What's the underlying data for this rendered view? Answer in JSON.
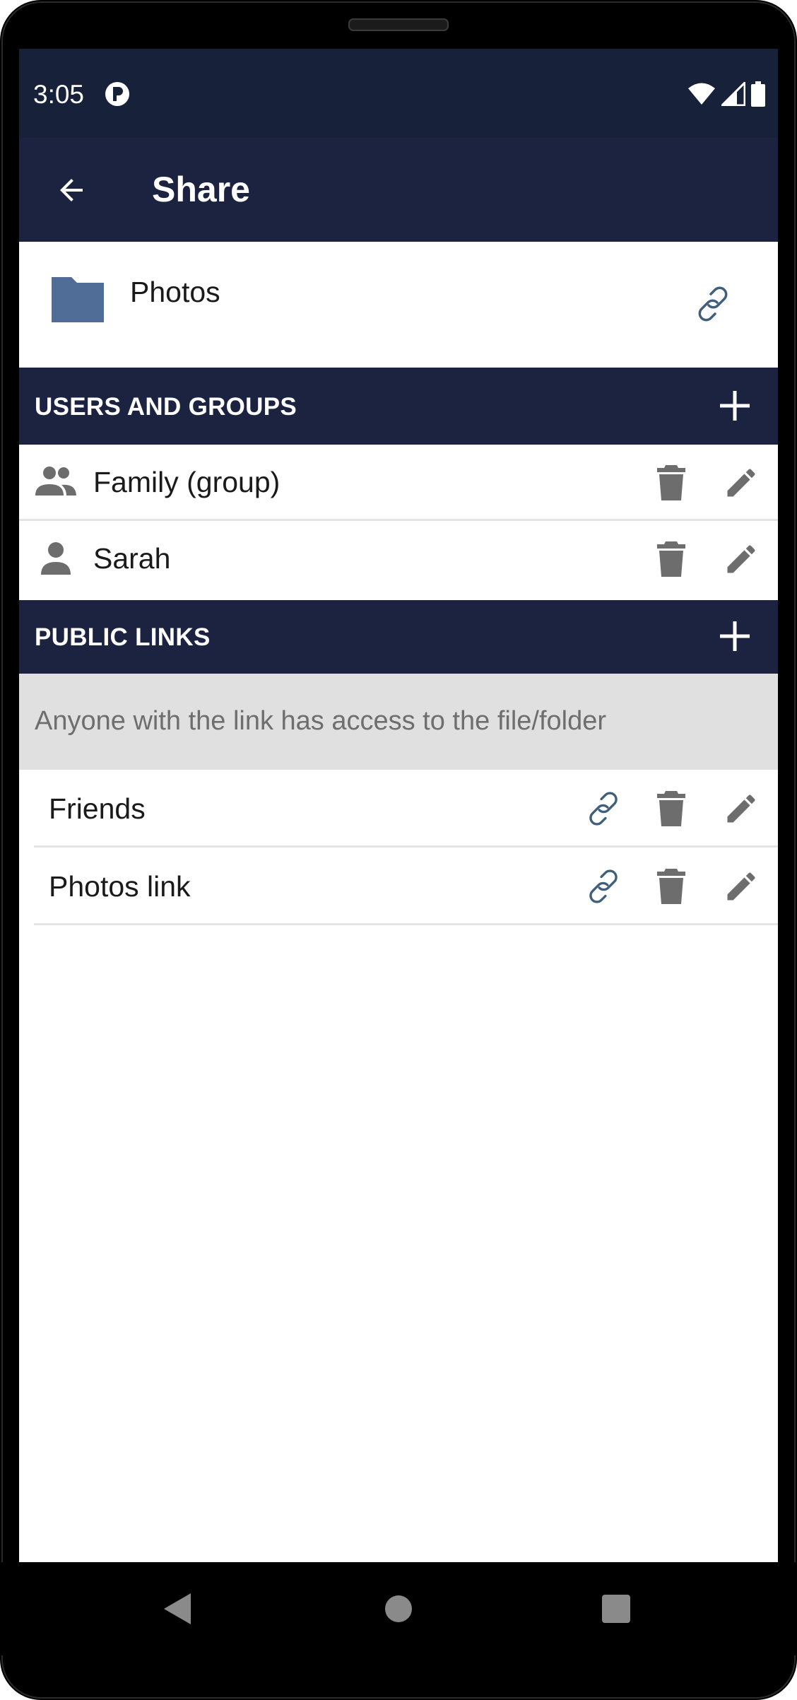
{
  "status_bar": {
    "time": "3:05",
    "app_icon": "pocket-cloud-icon",
    "icons": [
      "wifi-icon",
      "cell-signal-icon",
      "battery-icon"
    ]
  },
  "app_bar": {
    "back_icon": "arrow-back-icon",
    "title": "Share"
  },
  "file": {
    "icon": "folder-icon",
    "name": "Photos",
    "link_icon": "link-icon"
  },
  "users_section": {
    "title": "USERS AND GROUPS",
    "add_icon": "plus-icon",
    "items": [
      {
        "icon": "group-icon",
        "label": "Family (group)"
      },
      {
        "icon": "person-icon",
        "label": "Sarah"
      }
    ]
  },
  "links_section": {
    "title": "PUBLIC LINKS",
    "add_icon": "plus-icon",
    "info": "Anyone with the link has access to the file/folder",
    "items": [
      {
        "label": "Friends"
      },
      {
        "label": "Photos link"
      }
    ]
  },
  "colors": {
    "status_bar_bg": "#18213a",
    "app_bar_bg": "#1c2340",
    "folder_icon": "#4f6d96",
    "action_icon": "#6d6d6d",
    "link_icon": "#3f5f7a",
    "info_bg": "#e0e0e0"
  },
  "nav_bar": {
    "icons": [
      "nav-back-icon",
      "nav-home-icon",
      "nav-recents-icon"
    ]
  }
}
